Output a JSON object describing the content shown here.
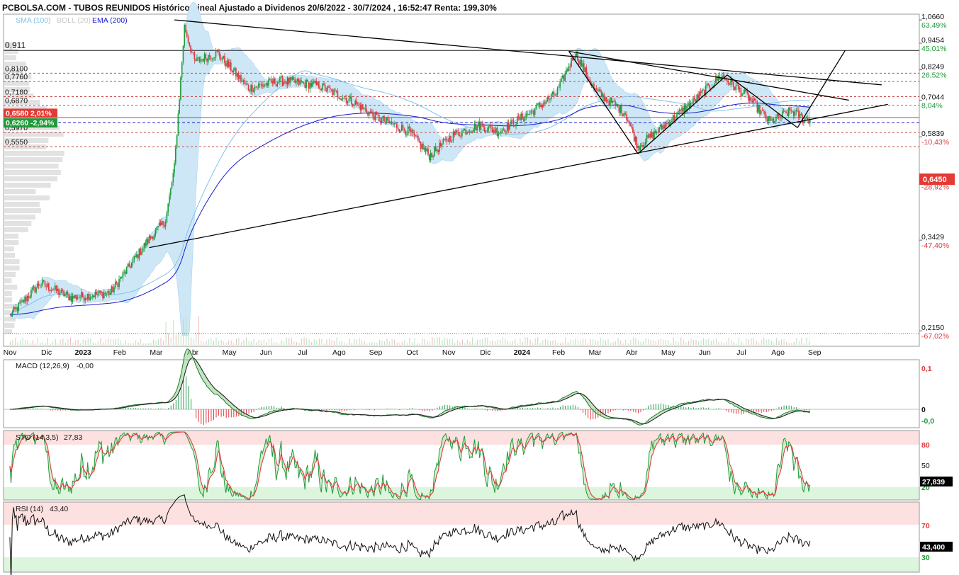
{
  "header": {
    "title": "PCBOLSA.COM - TUBOS REUNIDOS Histórico Lineal Ajustado a Dividenos 20/6/2022 - 30/7/2024 , 16:52:47 Renta: 199,30%",
    "legend": [
      {
        "label": "SMA (100)",
        "color": "#7ec3ec"
      },
      {
        "label": "BOLL (20)",
        "color": "#c8c8c8"
      },
      {
        "label": "EMA (200)",
        "color": "#1a1acc"
      }
    ]
  },
  "colors": {
    "up": "#1f9b3a",
    "down": "#e0393e",
    "boll_fill": "#cde7f7",
    "sma": "#7ec3ec",
    "ema": "#1a1acc",
    "level_line": "#c84848",
    "current_price_badge": "#e53935"
  },
  "chart_data": [
    {
      "type": "line",
      "name": "price",
      "ylim": [
        0.2,
        1.09
      ],
      "y_scale": "log",
      "x_labels": [
        {
          "label": "Nov",
          "bold": false
        },
        {
          "label": "Dic",
          "bold": false
        },
        {
          "label": "2023",
          "bold": true
        },
        {
          "label": "Feb",
          "bold": false
        },
        {
          "label": "Mar",
          "bold": false
        },
        {
          "label": "Abr",
          "bold": false
        },
        {
          "label": "May",
          "bold": false
        },
        {
          "label": "Jun",
          "bold": false
        },
        {
          "label": "Jul",
          "bold": false
        },
        {
          "label": "Ago",
          "bold": false
        },
        {
          "label": "Sep",
          "bold": false
        },
        {
          "label": "Oct",
          "bold": false
        },
        {
          "label": "Nov",
          "bold": false
        },
        {
          "label": "Dic",
          "bold": false
        },
        {
          "label": "2024",
          "bold": true
        },
        {
          "label": "Feb",
          "bold": false
        },
        {
          "label": "Mar",
          "bold": false
        },
        {
          "label": "Abr",
          "bold": false
        },
        {
          "label": "May",
          "bold": false
        },
        {
          "label": "Jun",
          "bold": false
        },
        {
          "label": "Jul",
          "bold": false
        },
        {
          "label": "Ago",
          "bold": false
        },
        {
          "label": "Sep",
          "bold": false
        }
      ],
      "right_axis": [
        {
          "price": "1,0660",
          "pct": "63,49%",
          "pct_color": "#1f9b3a"
        },
        {
          "price": "0,9454",
          "pct": "45,01%",
          "pct_color": "#1f9b3a"
        },
        {
          "price": "0,8249",
          "pct": "26,52%",
          "pct_color": "#1f9b3a"
        },
        {
          "price": "0,7044",
          "pct": "8,04%",
          "pct_color": "#1f9b3a"
        },
        {
          "price": "0,5839",
          "pct": "-10,43%",
          "pct_color": "#e0393e"
        },
        {
          "price": "0,4634",
          "pct": "-28,92%",
          "pct_color": "#e0393e"
        },
        {
          "price": "0,3429",
          "pct": "-47,40%",
          "pct_color": "#e0393e"
        },
        {
          "price": "0,2150",
          "pct": "-67,02%",
          "pct_color": "#e0393e"
        }
      ],
      "current_price": "0,6450",
      "levels": [
        {
          "label": "0,911",
          "value": 0.911,
          "style": "solid"
        },
        {
          "label": "0,8100",
          "value": 0.81,
          "style": "dashed"
        },
        {
          "label": "0,7760",
          "value": 0.776,
          "style": "dashed"
        },
        {
          "label": "0,7180",
          "value": 0.718,
          "style": "dashed"
        },
        {
          "label": "0,6870",
          "value": 0.687,
          "style": "dashed"
        },
        {
          "label": "0,5970",
          "value": 0.597,
          "style": "dashed"
        },
        {
          "label": "0,5550",
          "value": 0.555,
          "style": "dashed"
        }
      ],
      "badges": [
        {
          "label": "0,6580 2,01%",
          "value": 0.658,
          "color": "#e53935"
        },
        {
          "label": "0,6260 -2,94%",
          "value": 0.626,
          "color": "#1f9b3a"
        }
      ],
      "waypoints": [
        {
          "x": "2022-11-01",
          "y": 0.232
        },
        {
          "x": "2022-11-25",
          "y": 0.275
        },
        {
          "x": "2022-12-20",
          "y": 0.255
        },
        {
          "x": "2023-01-20",
          "y": 0.262
        },
        {
          "x": "2023-02-20",
          "y": 0.345
        },
        {
          "x": "2023-03-05",
          "y": 0.38
        },
        {
          "x": "2023-03-12",
          "y": 0.5
        },
        {
          "x": "2023-03-20",
          "y": 1.03
        },
        {
          "x": "2023-03-28",
          "y": 0.86
        },
        {
          "x": "2023-04-15",
          "y": 0.9
        },
        {
          "x": "2023-05-10",
          "y": 0.75
        },
        {
          "x": "2023-06-05",
          "y": 0.78
        },
        {
          "x": "2023-07-05",
          "y": 0.76
        },
        {
          "x": "2023-08-01",
          "y": 0.7
        },
        {
          "x": "2023-08-20",
          "y": 0.645
        },
        {
          "x": "2023-09-15",
          "y": 0.6
        },
        {
          "x": "2023-10-01",
          "y": 0.53
        },
        {
          "x": "2023-10-20",
          "y": 0.59
        },
        {
          "x": "2023-11-10",
          "y": 0.62
        },
        {
          "x": "2023-11-25",
          "y": 0.6
        },
        {
          "x": "2023-12-20",
          "y": 0.66
        },
        {
          "x": "2024-01-10",
          "y": 0.73
        },
        {
          "x": "2024-01-25",
          "y": 0.9
        },
        {
          "x": "2024-02-10",
          "y": 0.74
        },
        {
          "x": "2024-03-05",
          "y": 0.66
        },
        {
          "x": "2024-03-15",
          "y": 0.555
        },
        {
          "x": "2024-04-10",
          "y": 0.635
        },
        {
          "x": "2024-04-28",
          "y": 0.7
        },
        {
          "x": "2024-05-20",
          "y": 0.8
        },
        {
          "x": "2024-06-10",
          "y": 0.72
        },
        {
          "x": "2024-06-28",
          "y": 0.63
        },
        {
          "x": "2024-07-15",
          "y": 0.668
        },
        {
          "x": "2024-07-25",
          "y": 0.64
        }
      ],
      "trendlines": [
        {
          "from": {
            "x": "2023-03-12",
            "y": 1.066
          },
          "to": {
            "x": "2024-09-25",
            "y": 0.763
          }
        },
        {
          "from": {
            "x": "2023-02-20",
            "y": 0.33
          },
          "to": {
            "x": "2024-09-30",
            "y": 0.69
          }
        },
        {
          "from": {
            "x": "2024-01-20",
            "y": 0.907
          },
          "to": {
            "x": "2024-08-30",
            "y": 0.705
          }
        },
        {
          "from": {
            "x": "2024-01-20",
            "y": 0.907
          },
          "to": {
            "x": "2024-03-15",
            "y": 0.535
          }
        },
        {
          "from": {
            "x": "2024-03-15",
            "y": 0.535
          },
          "to": {
            "x": "2024-05-25",
            "y": 0.803
          }
        },
        {
          "from": {
            "x": "2024-05-25",
            "y": 0.803
          },
          "to": {
            "x": "2024-07-20",
            "y": 0.612
          }
        },
        {
          "from": {
            "x": "2024-07-20",
            "y": 0.612
          },
          "to": {
            "x": "2024-08-27",
            "y": 0.911
          }
        }
      ]
    },
    {
      "type": "line",
      "name": "MACD",
      "label": "MACD (12,26,9)",
      "value": "-0,00",
      "right_axis": [
        "0,1",
        "0",
        "-0,0"
      ],
      "ylim": [
        -0.045,
        0.12
      ]
    },
    {
      "type": "line",
      "name": "STO",
      "label": "STO (14,3,5)",
      "value": "27,83",
      "right_axis": [
        "80",
        "50",
        "20"
      ],
      "current": "27,839",
      "ylim": [
        0,
        100
      ]
    },
    {
      "type": "line",
      "name": "RSI",
      "label": "RSI (14)",
      "value": "43,40",
      "right_axis": [
        "70",
        "30"
      ],
      "current": "43,400",
      "ylim": [
        10,
        90
      ]
    }
  ]
}
